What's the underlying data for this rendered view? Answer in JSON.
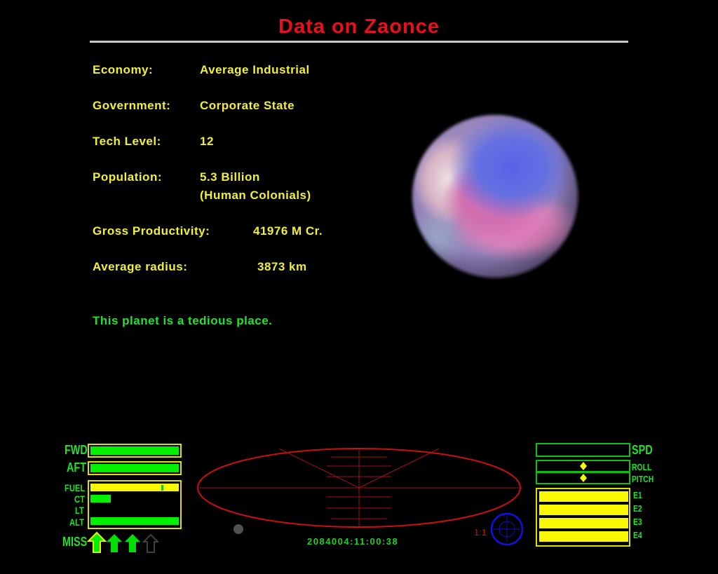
{
  "title": "Data on Zaonce",
  "info": {
    "economy_label": "Economy:",
    "economy": "Average Industrial",
    "government_label": "Government:",
    "government": "Corporate State",
    "tech_label": "Tech Level:",
    "tech": "12",
    "population_label": "Population:",
    "population": "5.3 Billion",
    "species": "(Human Colonials)",
    "productivity_label": "Gross Productivity:",
    "productivity": "41976 M Cr.",
    "radius_label": "Average radius:",
    "radius": "3873 km",
    "description": "This planet is a tedious place."
  },
  "hud": {
    "fwd": "FWD",
    "aft": "AFT",
    "fuel": "FUEL",
    "ct": "CT",
    "lt": "LT",
    "alt": "ALT",
    "miss": "MISS",
    "spd": "SPD",
    "roll": "ROLL",
    "pitch": "PITCH",
    "e1": "E1",
    "e2": "E2",
    "e3": "E3",
    "e4": "E4",
    "scale": "1:1",
    "clock": "2084004:11:00:38",
    "levels": {
      "fwd_shield": 1.0,
      "aft_shield": 1.0,
      "fuel": 1.0,
      "cabin_temp": 0.23,
      "laser_temp": 0.0,
      "altitude": 1.0,
      "speed": 0.0,
      "missiles_loaded": 3,
      "missiles_total": 4
    }
  },
  "colors": {
    "title": "#e8101a",
    "label": "#f2f034",
    "description": "#24e030",
    "hud_green": "#22e02a",
    "hud_yellow": "#f8f800",
    "scanner": "#c81010",
    "compass": "#1010e0"
  }
}
